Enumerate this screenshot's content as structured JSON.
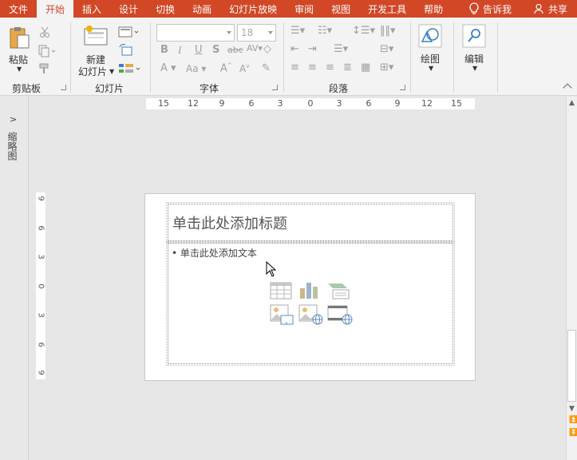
{
  "tabs": [
    {
      "label": "文件",
      "active": false
    },
    {
      "label": "开始",
      "active": true
    },
    {
      "label": "插入",
      "active": false
    },
    {
      "label": "设计",
      "active": false
    },
    {
      "label": "切换",
      "active": false
    },
    {
      "label": "动画",
      "active": false
    },
    {
      "label": "幻灯片放映",
      "active": false
    },
    {
      "label": "审阅",
      "active": false
    },
    {
      "label": "视图",
      "active": false
    },
    {
      "label": "开发工具",
      "active": false
    },
    {
      "label": "帮助",
      "active": false
    }
  ],
  "tell_me": "告诉我",
  "share": "共享",
  "ribbon": {
    "clipboard": {
      "paste": "粘贴",
      "group": "剪贴板"
    },
    "slides": {
      "new_slide_line1": "新建",
      "new_slide_line2": "幻灯片",
      "group": "幻灯片"
    },
    "font": {
      "font_name": "",
      "font_size": "18",
      "group": "字体"
    },
    "paragraph": {
      "group": "段落"
    },
    "drawing": {
      "label": "绘图"
    },
    "editing": {
      "label": "编辑"
    }
  },
  "thumbnail_pane": {
    "label": "缩略图"
  },
  "hruler": [
    "15",
    "12",
    "9",
    "6",
    "3",
    "0",
    "3",
    "6",
    "9",
    "12",
    "15"
  ],
  "vruler": [
    "9",
    "6",
    "3",
    "0",
    "3",
    "6",
    "9"
  ],
  "slide": {
    "title_placeholder": "单击此处添加标题",
    "body_placeholder": "• 单击此处添加文本"
  },
  "colors": {
    "accent": "#d24726",
    "ribbon_bg": "#f3f3f3"
  }
}
